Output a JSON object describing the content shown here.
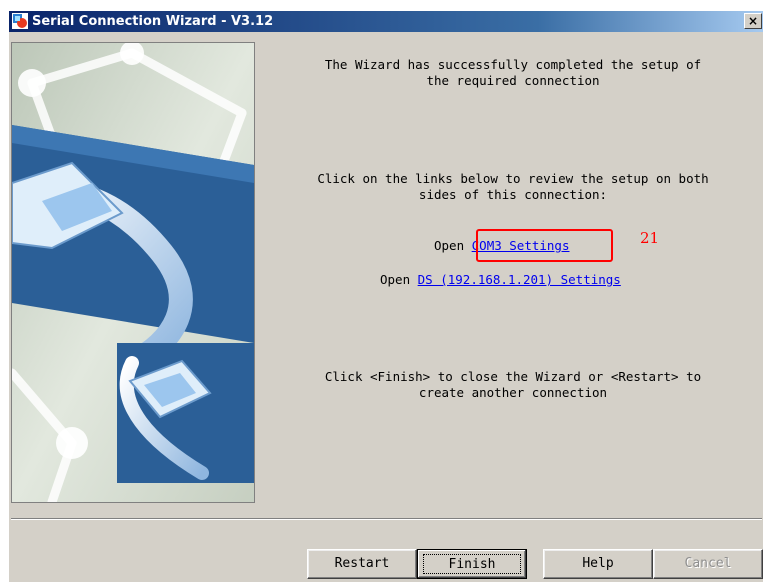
{
  "window": {
    "title": "Serial Connection Wizard - V3.12",
    "close_label": "×"
  },
  "content": {
    "message_1": [
      "The Wizard has successfully completed the setup of",
      "the required connection"
    ],
    "message_2": [
      "Click on the links below to review the setup on both",
      "sides of this connection:"
    ],
    "links": [
      {
        "prefix": "Open ",
        "label": "COM3 Settings"
      },
      {
        "prefix": "Open ",
        "label": "DS (192.168.1.201) Settings"
      }
    ],
    "message_3": [
      "Click <Finish> to close the Wizard or <Restart> to",
      "create another connection"
    ],
    "annotation": "21"
  },
  "buttons": {
    "restart": "Restart",
    "finish": "Finish",
    "help": "Help",
    "cancel": "Cancel"
  },
  "colors": {
    "link": "#0000ee",
    "highlight": "#ff0000",
    "titlebar": "#0a246a",
    "face": "#d4d0c8"
  }
}
